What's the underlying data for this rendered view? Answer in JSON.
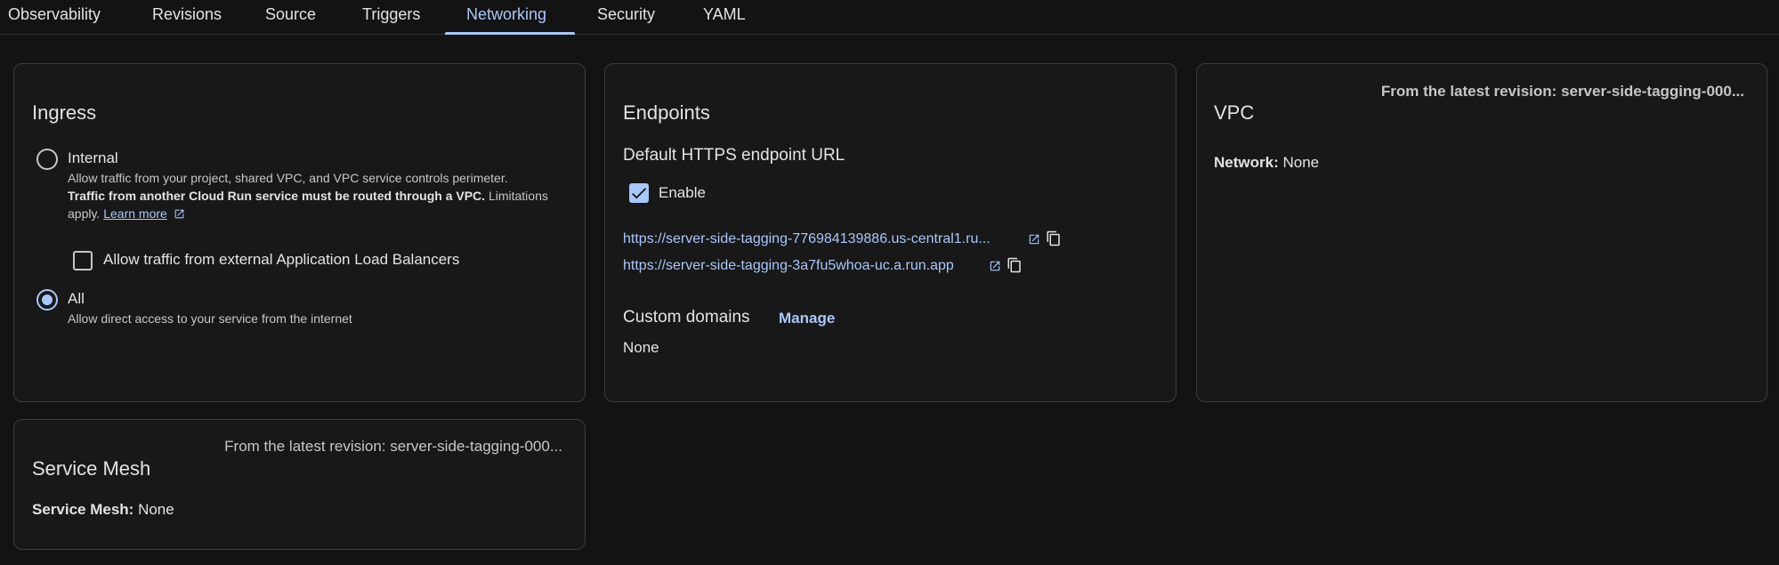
{
  "tabs": [
    "Observability",
    "Revisions",
    "Source",
    "Triggers",
    "Networking",
    "Security",
    "YAML"
  ],
  "active_tab": "Networking",
  "ingress": {
    "title": "Ingress",
    "internal_label": "Internal",
    "internal_desc1": "Allow traffic from your project, shared VPC, and VPC service controls perimeter.",
    "internal_desc2_bold": "Traffic from another Cloud Run service must be routed through a VPC.",
    "internal_desc2_rest": " Limitations",
    "internal_desc3": "apply. ",
    "learn_more": "Learn more",
    "alb_label": "Allow traffic from external Application Load Balancers",
    "all_label": "All",
    "all_desc": "Allow direct access to your service from the internet",
    "selected": "All"
  },
  "endpoints": {
    "title": "Endpoints",
    "default_url_title": "Default HTTPS endpoint URL",
    "enable_label": "Enable",
    "urls": [
      "https://server-side-tagging-776984139886.us-central1.ru...",
      "https://server-side-tagging-3a7fu5whoa-uc.a.run.app"
    ],
    "custom_domains_title": "Custom domains",
    "manage_label": "Manage",
    "custom_domains_value": "None"
  },
  "vpc": {
    "revision_note": "From the latest revision: server-side-tagging-000...",
    "title": "VPC",
    "network_label": "Network:",
    "network_value": "None"
  },
  "service_mesh": {
    "revision_note": "From the latest revision: server-side-tagging-000...",
    "title": "Service Mesh",
    "label": "Service Mesh:",
    "value": "None"
  },
  "colors": {
    "accent": "#a8c7fa",
    "background": "#131313",
    "card_border": "#3c3c3c"
  },
  "icons": [
    "open-in-new-icon",
    "copy-icon",
    "checkmark-icon"
  ]
}
